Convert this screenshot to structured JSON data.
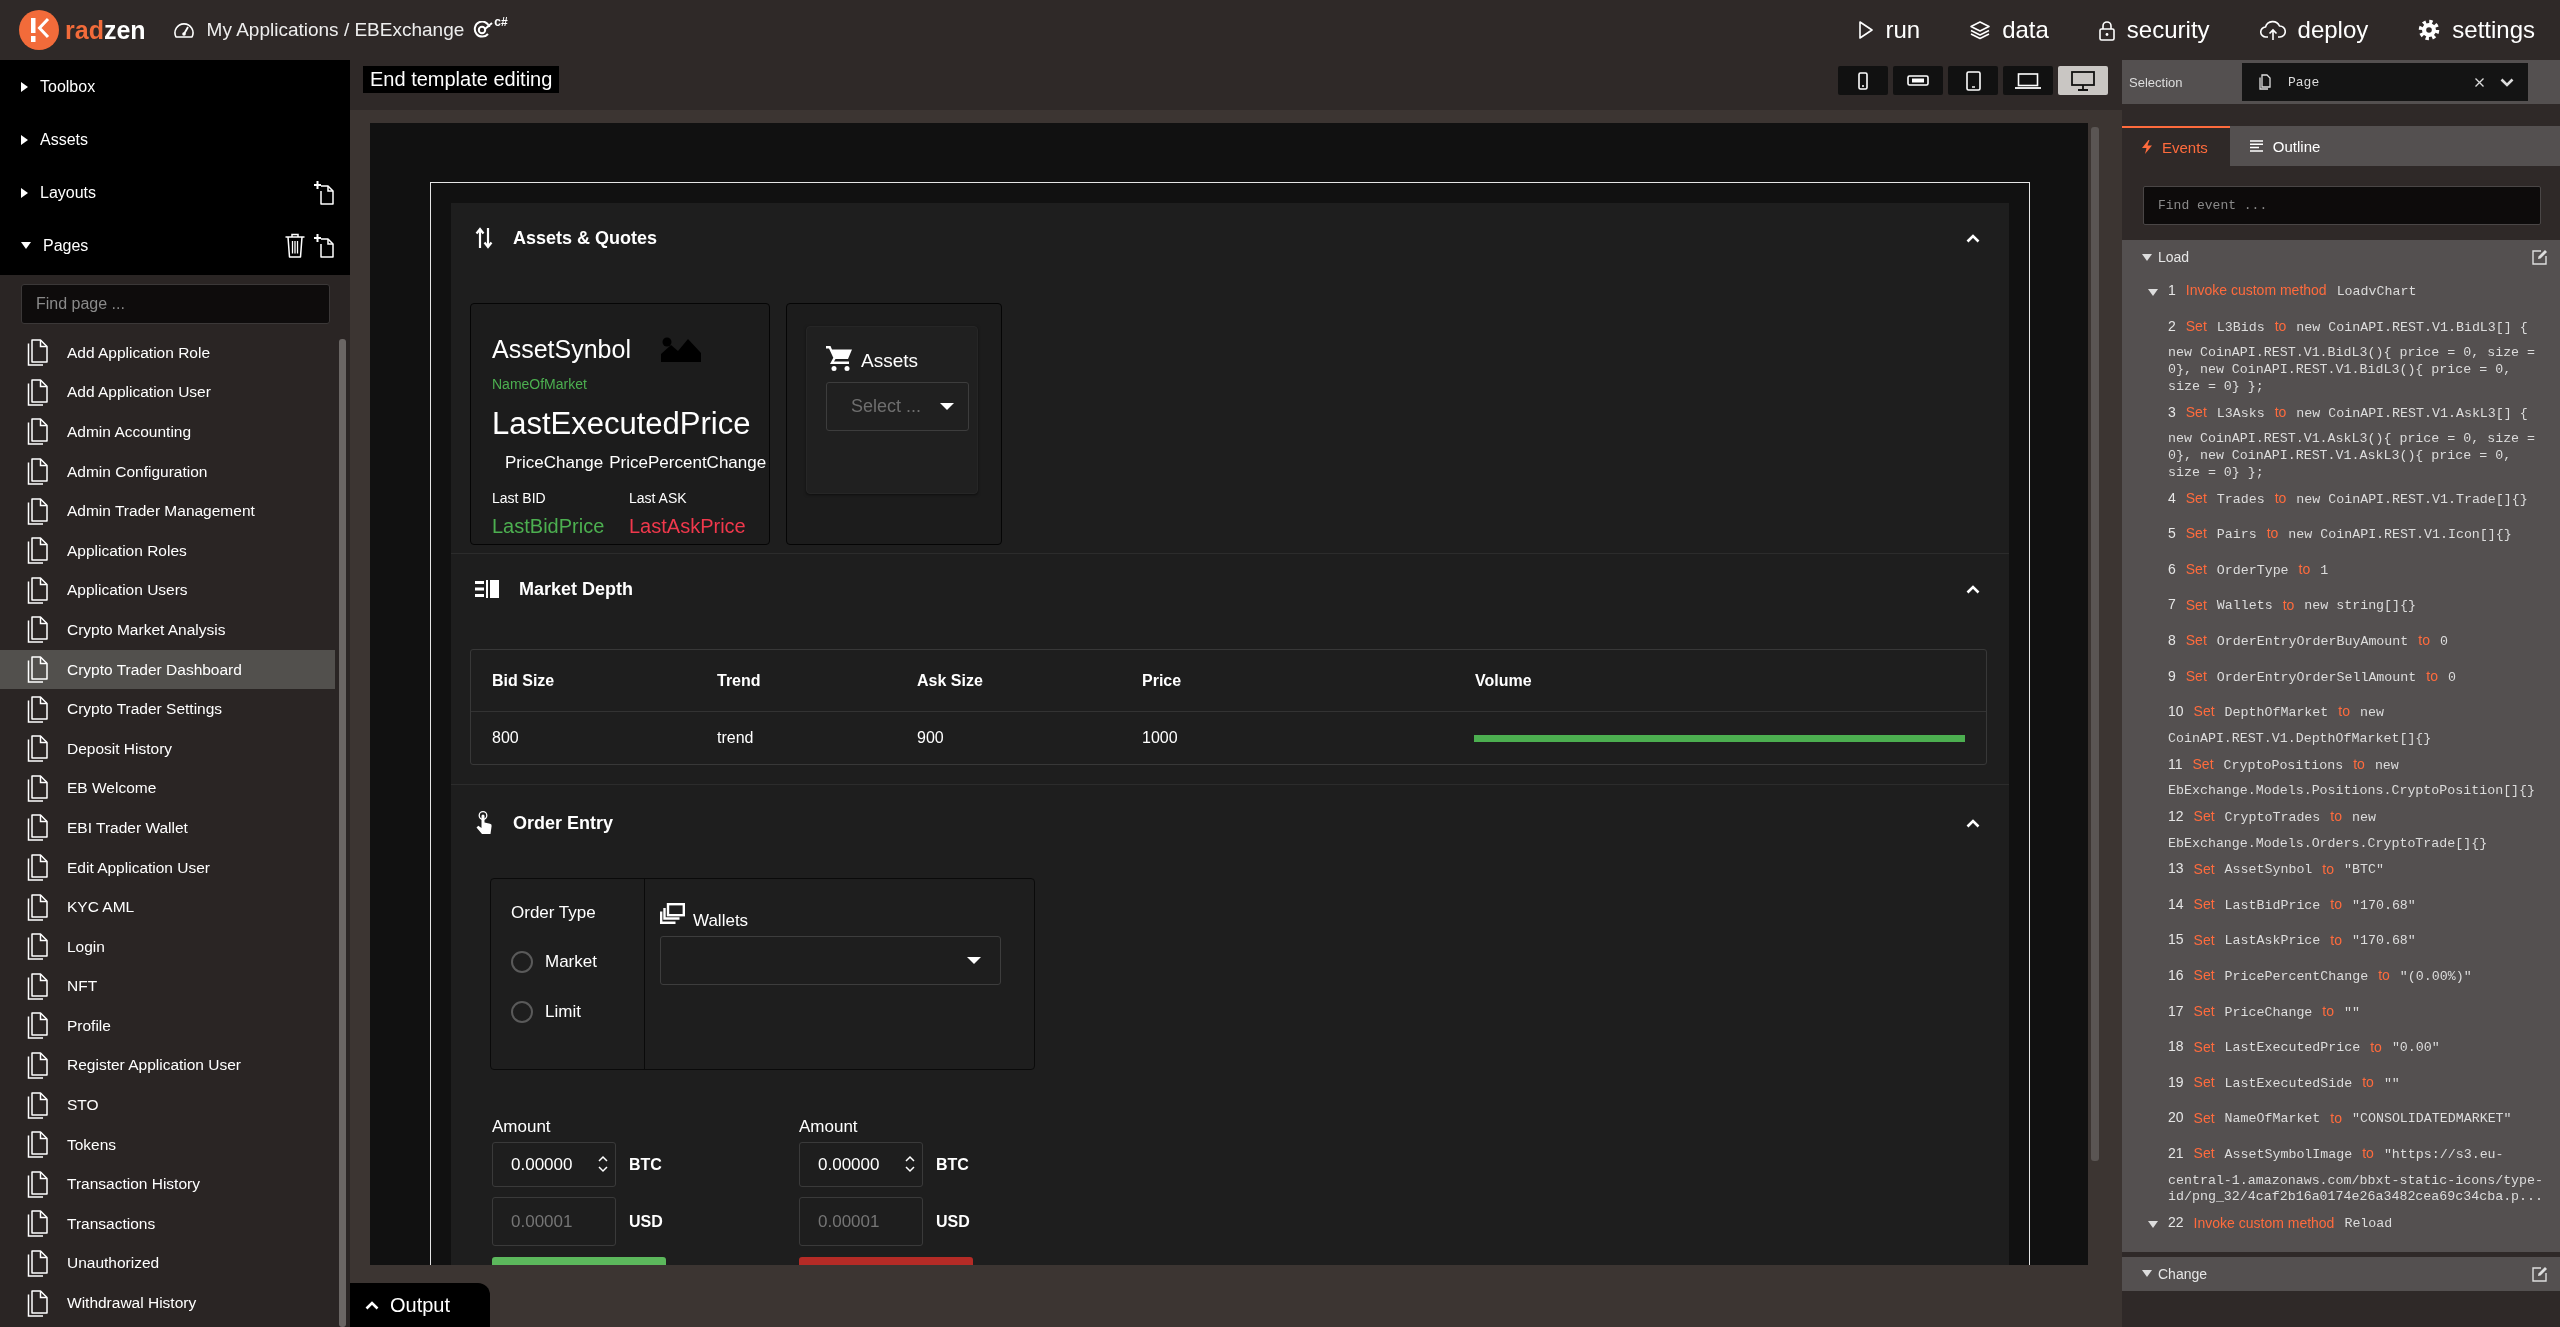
{
  "app_bar": {
    "logo": {
      "accent": "rad",
      "plain": "zen"
    },
    "breadcrumb": "My Applications / EBExchange",
    "language_badge": "c#",
    "nav": [
      {
        "kind": "run",
        "label": "run"
      },
      {
        "kind": "data",
        "label": "data"
      },
      {
        "kind": "security",
        "label": "security"
      },
      {
        "kind": "deploy",
        "label": "deploy"
      },
      {
        "kind": "settings",
        "label": "settings"
      }
    ]
  },
  "sidebar": {
    "sections": [
      {
        "label": "Toolbox",
        "expanded": false
      },
      {
        "label": "Assets",
        "expanded": false
      },
      {
        "label": "Layouts",
        "expanded": false,
        "tools": [
          {
            "kind": "add"
          }
        ]
      },
      {
        "label": "Pages",
        "expanded": true,
        "tools": [
          {
            "kind": "delete"
          },
          {
            "kind": "add"
          }
        ]
      }
    ],
    "page_search": {
      "placeholder": "Find page ..."
    },
    "pages": [
      {
        "label": "Add Application Role",
        "selected": false
      },
      {
        "label": "Add Application User",
        "selected": false
      },
      {
        "label": "Admin Accounting",
        "selected": false
      },
      {
        "label": "Admin Configuration",
        "selected": false
      },
      {
        "label": "Admin Trader Management",
        "selected": false
      },
      {
        "label": "Application Roles",
        "selected": false
      },
      {
        "label": "Application Users",
        "selected": false
      },
      {
        "label": "Crypto Market Analysis",
        "selected": false
      },
      {
        "label": "Crypto Trader Dashboard",
        "selected": true
      },
      {
        "label": "Crypto Trader Settings",
        "selected": false
      },
      {
        "label": "Deposit History",
        "selected": false
      },
      {
        "label": "EB Welcome",
        "selected": false
      },
      {
        "label": "EBI Trader Wallet",
        "selected": false
      },
      {
        "label": "Edit Application User",
        "selected": false
      },
      {
        "label": "KYC AML",
        "selected": false
      },
      {
        "label": "Login",
        "selected": false
      },
      {
        "label": "NFT",
        "selected": false
      },
      {
        "label": "Profile",
        "selected": false
      },
      {
        "label": "Register Application User",
        "selected": false
      },
      {
        "label": "STO",
        "selected": false
      },
      {
        "label": "Tokens",
        "selected": false
      },
      {
        "label": "Transaction History",
        "selected": false
      },
      {
        "label": "Transactions",
        "selected": false
      },
      {
        "label": "Unauthorized",
        "selected": false
      },
      {
        "label": "Withdrawal History",
        "selected": false
      }
    ]
  },
  "designer": {
    "template_banner": "End template editing",
    "devices": [
      {
        "kind": "phone",
        "selected": false
      },
      {
        "kind": "phone-landscape",
        "selected": false
      },
      {
        "kind": "tablet",
        "selected": false
      },
      {
        "kind": "laptop",
        "selected": false
      },
      {
        "kind": "desktop",
        "selected": true
      }
    ],
    "canvas": {
      "sections": [
        {
          "kind": "quotes",
          "title": "Assets & Quotes",
          "expanded": true,
          "quote": {
            "symbol": "AssetSynbol",
            "market": "NameOfMarket",
            "price": "LastExecutedPrice",
            "change": "PriceChange",
            "percent_change": "PricePercentChange",
            "bid_label": "Last BID",
            "ask_label": "Last ASK",
            "bid": "LastBidPrice",
            "ask": "LastAskPrice"
          },
          "assets": {
            "title": "Assets",
            "select": {
              "placeholder": "Select ..."
            }
          }
        },
        {
          "kind": "depth",
          "title": "Market Depth",
          "expanded": true,
          "table": {
            "columns": [
              "Bid Size",
              "Trend",
              "Ask Size",
              "Price",
              "Volume"
            ],
            "rows": [
              {
                "cells": [
                  "800",
                  "trend",
                  "900",
                  "1000"
                ],
                "volume": {
                  "level": 1
                }
              }
            ]
          }
        },
        {
          "kind": "order",
          "title": "Order Entry",
          "expanded": true,
          "order_type": {
            "label": "Order Type",
            "options": [
              {
                "label": "Market",
                "selected": false
              },
              {
                "label": "Limit",
                "selected": false
              }
            ]
          },
          "wallets": {
            "label": "Wallets"
          },
          "sides": [
            {
              "kind": "buy",
              "amount_label": "Amount",
              "amount": "0.00000",
              "asset": "BTC",
              "usd_placeholder": "0.00001",
              "currency": "USD"
            },
            {
              "kind": "sell",
              "amount_label": "Amount",
              "amount": "0.00000",
              "asset": "BTC",
              "usd_placeholder": "0.00001",
              "currency": "USD"
            }
          ]
        }
      ]
    },
    "output_tab": "Output"
  },
  "properties": {
    "selection": {
      "label": "Selection",
      "value": "Page"
    },
    "tabs": [
      {
        "kind": "events",
        "label": "Events",
        "selected": true
      },
      {
        "kind": "outline",
        "label": "Outline",
        "selected": false
      }
    ],
    "event_search": {
      "placeholder": "Find event ..."
    },
    "events": [
      {
        "label": "Load",
        "expanded": true,
        "actions": [
          {
            "number": "1",
            "kind": "invoke",
            "verb": "Invoke custom method",
            "target": "LoadvChart",
            "expanded": true
          },
          {
            "number": "2",
            "kind": "set",
            "verb": "Set",
            "target": "L3Bids",
            "link": "to",
            "value": "new CoinAPI.REST.V1.BidL3[] { new CoinAPI.REST.V1.BidL3(){ price = 0, size = 0}, new CoinAPI.REST.V1.BidL3(){ price = 0, size = 0} };"
          },
          {
            "number": "3",
            "kind": "set",
            "verb": "Set",
            "target": "L3Asks",
            "link": "to",
            "value": "new CoinAPI.REST.V1.AskL3[] { new CoinAPI.REST.V1.AskL3(){ price = 0, size = 0}, new CoinAPI.REST.V1.AskL3(){ price = 0, size = 0} };"
          },
          {
            "number": "4",
            "kind": "set",
            "verb": "Set",
            "target": "Trades",
            "link": "to",
            "value": "new CoinAPI.REST.V1.Trade[]{}"
          },
          {
            "number": "5",
            "kind": "set",
            "verb": "Set",
            "target": "Pairs",
            "link": "to",
            "value": "new CoinAPI.REST.V1.Icon[]{}"
          },
          {
            "number": "6",
            "kind": "set",
            "verb": "Set",
            "target": "OrderType",
            "link": "to",
            "value": "1"
          },
          {
            "number": "7",
            "kind": "set",
            "verb": "Set",
            "target": "Wallets",
            "link": "to",
            "value": "new string[]{}"
          },
          {
            "number": "8",
            "kind": "set",
            "verb": "Set",
            "target": "OrderEntryOrderBuyAmount",
            "link": "to",
            "value": "0"
          },
          {
            "number": "9",
            "kind": "set",
            "verb": "Set",
            "target": "OrderEntryOrderSellAmount",
            "link": "to",
            "value": "0"
          },
          {
            "number": "10",
            "kind": "set",
            "verb": "Set",
            "target": "DepthOfMarket",
            "link": "to",
            "value": "new CoinAPI.REST.V1.DepthOfMarket[]{}"
          },
          {
            "number": "11",
            "kind": "set",
            "verb": "Set",
            "target": "CryptoPositions",
            "link": "to",
            "value": "new EbExchange.Models.Positions.CryptoPosition[]{}"
          },
          {
            "number": "12",
            "kind": "set",
            "verb": "Set",
            "target": "CryptoTrades",
            "link": "to",
            "value": "new EbExchange.Models.Orders.CryptoTrade[]{}"
          },
          {
            "number": "13",
            "kind": "set",
            "verb": "Set",
            "target": "AssetSynbol",
            "link": "to",
            "value": "\"BTC\""
          },
          {
            "number": "14",
            "kind": "set",
            "verb": "Set",
            "target": "LastBidPrice",
            "link": "to",
            "value": "\"170.68\""
          },
          {
            "number": "15",
            "kind": "set",
            "verb": "Set",
            "target": "LastAskPrice",
            "link": "to",
            "value": "\"170.68\""
          },
          {
            "number": "16",
            "kind": "set",
            "verb": "Set",
            "target": "PricePercentChange",
            "link": "to",
            "value": "\"(0.00%)\""
          },
          {
            "number": "17",
            "kind": "set",
            "verb": "Set",
            "target": "PriceChange",
            "link": "to",
            "value": "\"\""
          },
          {
            "number": "18",
            "kind": "set",
            "verb": "Set",
            "target": "LastExecutedPrice",
            "link": "to",
            "value": "\"0.00\""
          },
          {
            "number": "19",
            "kind": "set",
            "verb": "Set",
            "target": "LastExecutedSide",
            "link": "to",
            "value": "\"\""
          },
          {
            "number": "20",
            "kind": "set",
            "verb": "Set",
            "target": "NameOfMarket",
            "link": "to",
            "value": "\"CONSOLIDATEDMARKET\""
          },
          {
            "number": "21",
            "kind": "set",
            "verb": "Set",
            "target": "AssetSymbolImage",
            "link": "to",
            "value": "\"https://s3.eu-central-1.amazonaws.com/bbxt-static-icons/type-id/png_32/4caf2b16a0174e26a3482cea69c34cba.p..."
          },
          {
            "number": "22",
            "kind": "invoke",
            "verb": "Invoke custom method",
            "target": "Reload",
            "expanded": true
          }
        ]
      },
      {
        "label": "Change",
        "expanded": true
      }
    ]
  }
}
